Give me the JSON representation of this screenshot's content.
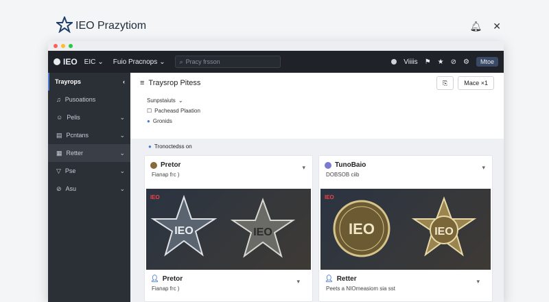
{
  "brand": {
    "title": "IEO Prazytiom"
  },
  "toolbar": {
    "logo": "IEO",
    "menu": "EIC",
    "context": "Fuio Pracnops",
    "search_placeholder": "Pracy frsson",
    "user_label": "Viiiis",
    "badge": "Mtoe"
  },
  "sidebar": {
    "header": "Trayrops",
    "items": [
      {
        "label": "Pusoations"
      },
      {
        "label": "Pelis"
      },
      {
        "label": "Pcntans"
      },
      {
        "label": "Retter"
      },
      {
        "label": "Pse"
      },
      {
        "label": "Asu"
      }
    ]
  },
  "main": {
    "title": "Traysrop Pitess",
    "buttons": {
      "icon_btn": "⎘",
      "more": "Mace ×1"
    },
    "filters": {
      "dropdown": "Sunpstaiuts",
      "option1": "Pacheasd Plaation",
      "option2": "Gronids"
    },
    "section": "Tronoctedss on"
  },
  "cards": [
    {
      "title": "Pretor",
      "sub": "Fianap frc )",
      "tag": "IEO",
      "foot_title": "Pretor",
      "foot_sub": "Fianap frc )"
    },
    {
      "title": "TunoBaio",
      "sub": "DOBSOB ciib",
      "tag": "IEO",
      "foot_title": "Retter",
      "foot_sub": "Peets a NIOmeasiom sia sst"
    }
  ]
}
